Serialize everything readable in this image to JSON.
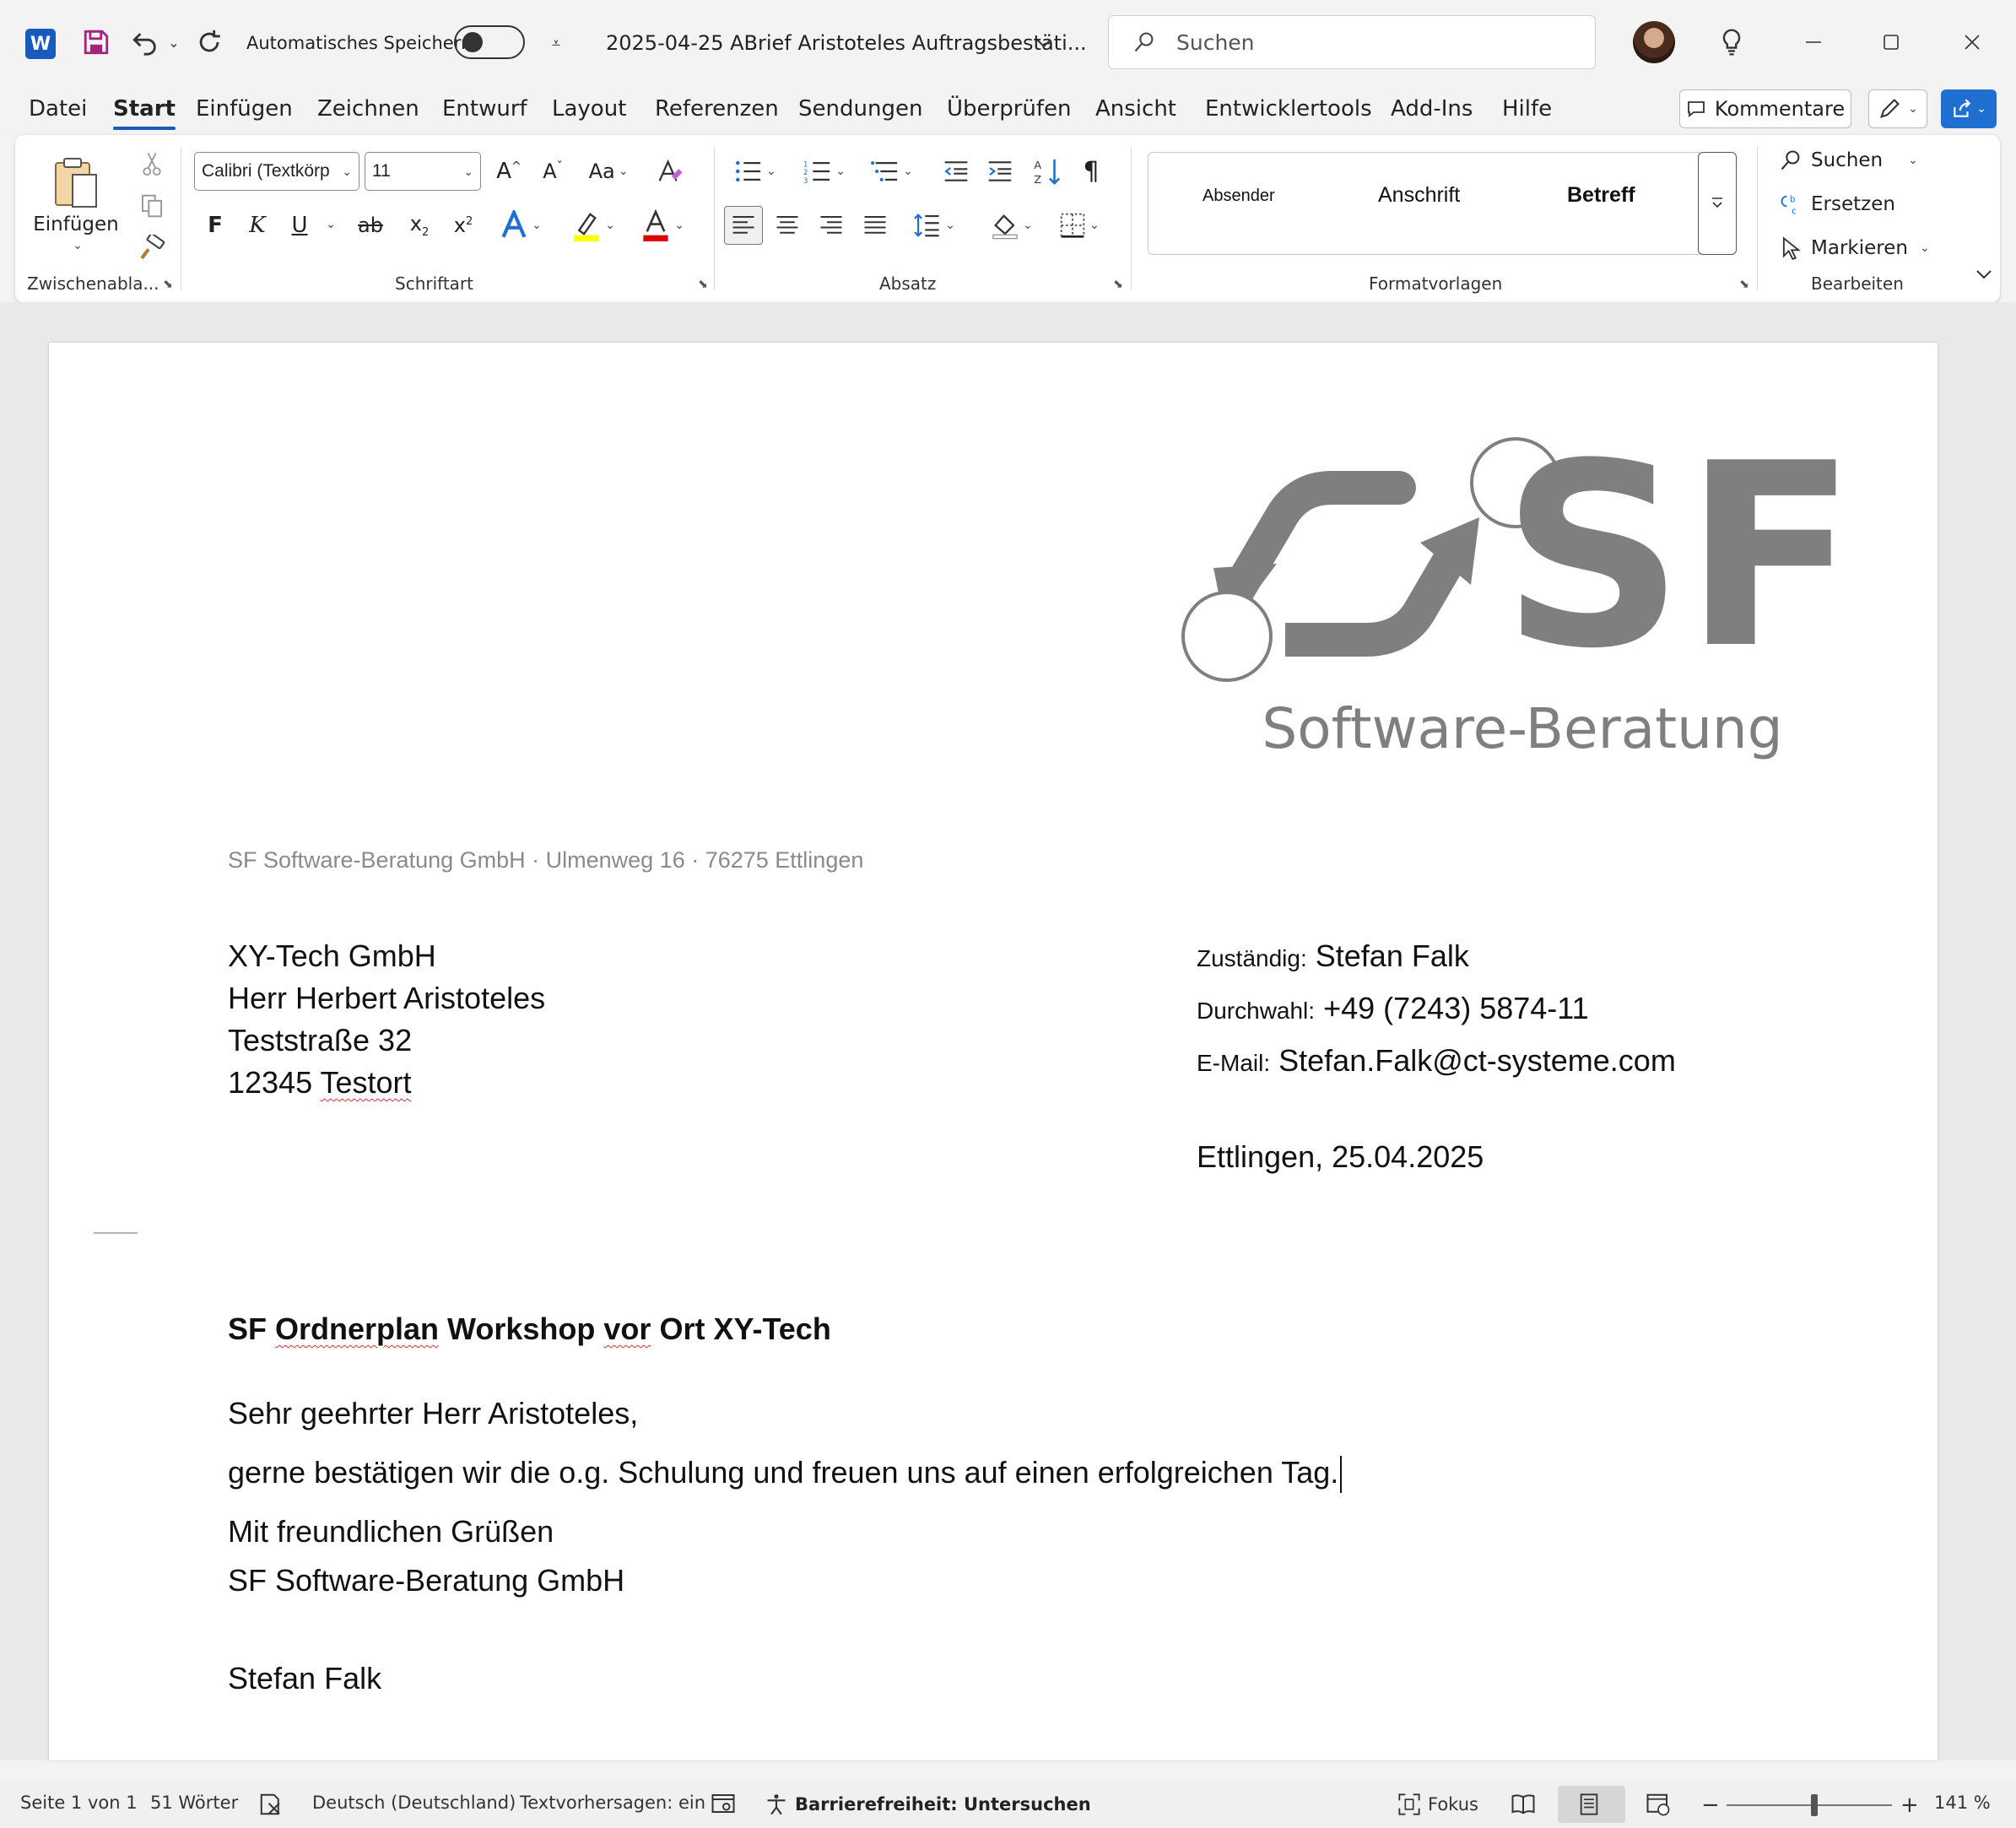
{
  "titlebar": {
    "app_icon_letter": "W",
    "autosave_label": "Automatisches Speichern",
    "doc_title": "2025-04-25 ABrief Aristoteles Auftragsbestäti...",
    "search_placeholder": "Suchen"
  },
  "menu": {
    "tabs": [
      "Datei",
      "Start",
      "Einfügen",
      "Zeichnen",
      "Entwurf",
      "Layout",
      "Referenzen",
      "Sendungen",
      "Überprüfen",
      "Ansicht",
      "Entwicklertools",
      "Add-Ins",
      "Hilfe"
    ],
    "active_tab": "Start",
    "comments_label": "Kommentare"
  },
  "ribbon": {
    "clipboard": {
      "paste_label": "Einfügen",
      "group_label": "Zwischenabla..."
    },
    "font": {
      "font_name": "Calibri (Textkörp",
      "font_size": "11",
      "case_label": "Aa",
      "bold": "F",
      "italic": "K",
      "underline": "U",
      "strike": "ab",
      "group_label": "Schriftart",
      "highlight_color": "#ffff00",
      "font_color": "#e00000"
    },
    "paragraph": {
      "group_label": "Absatz"
    },
    "styles": {
      "items": [
        "Absender",
        "Anschrift",
        "Betreff"
      ],
      "group_label": "Formatvorlagen"
    },
    "editing": {
      "find": "Suchen",
      "replace": "Ersetzen",
      "select": "Markieren",
      "group_label": "Bearbeiten"
    }
  },
  "document": {
    "logo_text_big": "SF",
    "logo_text_sub": "Software-Beratung",
    "sender_line": "SF Software-Beratung GmbH · Ulmenweg 16 · 76275 Ettlingen",
    "recipient": {
      "company": "XY-Tech GmbH",
      "person": "Herr Herbert Aristoteles",
      "street": "Teststraße 32",
      "zip": "12345",
      "city": "Testort"
    },
    "contact": {
      "responsible_label": "Zuständig:",
      "responsible": "Stefan Falk",
      "phone_label": "Durchwahl:",
      "phone": "+49 (7243) 5874-11",
      "email_label": "E-Mail:",
      "email": "Stefan.Falk@ct-systeme.com"
    },
    "date_line": "Ettlingen, 25.04.2025",
    "subject_pre": "SF ",
    "subject_err1": "Ordnerplan",
    "subject_mid": " Workshop ",
    "subject_err2": "vor",
    "subject_post": " Ort XY-Tech",
    "salutation": "Sehr geehrter Herr Aristoteles,",
    "body": "gerne bestätigen wir die o.g. Schulung und freuen uns auf einen erfolgreichen Tag.",
    "closing": "Mit freundlichen Grüßen",
    "company_sign": "SF Software-Beratung GmbH",
    "signer": "Stefan Falk"
  },
  "statusbar": {
    "page": "Seite 1 von 1",
    "words": "51 Wörter",
    "language": "Deutsch (Deutschland)",
    "predictions": "Textvorhersagen: ein",
    "accessibility": "Barrierefreiheit: Untersuchen",
    "focus": "Fokus",
    "zoom": "141 %"
  },
  "colors": {
    "accent": "#185abd",
    "logo_gray": "#7f7f7f"
  }
}
